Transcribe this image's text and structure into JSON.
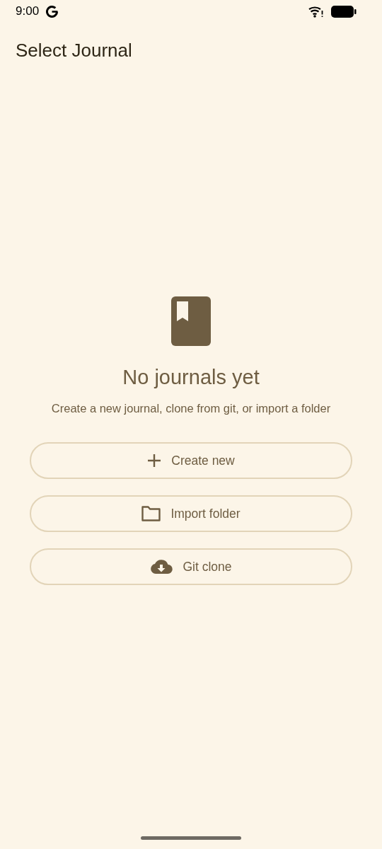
{
  "status_bar": {
    "time": "9:00"
  },
  "app_bar": {
    "title": "Select Journal"
  },
  "empty_state": {
    "heading": "No journals yet",
    "message": "Create a new journal, clone from git, or import a folder"
  },
  "buttons": [
    {
      "kind": "create",
      "label": "Create new"
    },
    {
      "kind": "import",
      "label": "Import folder"
    },
    {
      "kind": "clone",
      "label": "Git clone"
    }
  ]
}
